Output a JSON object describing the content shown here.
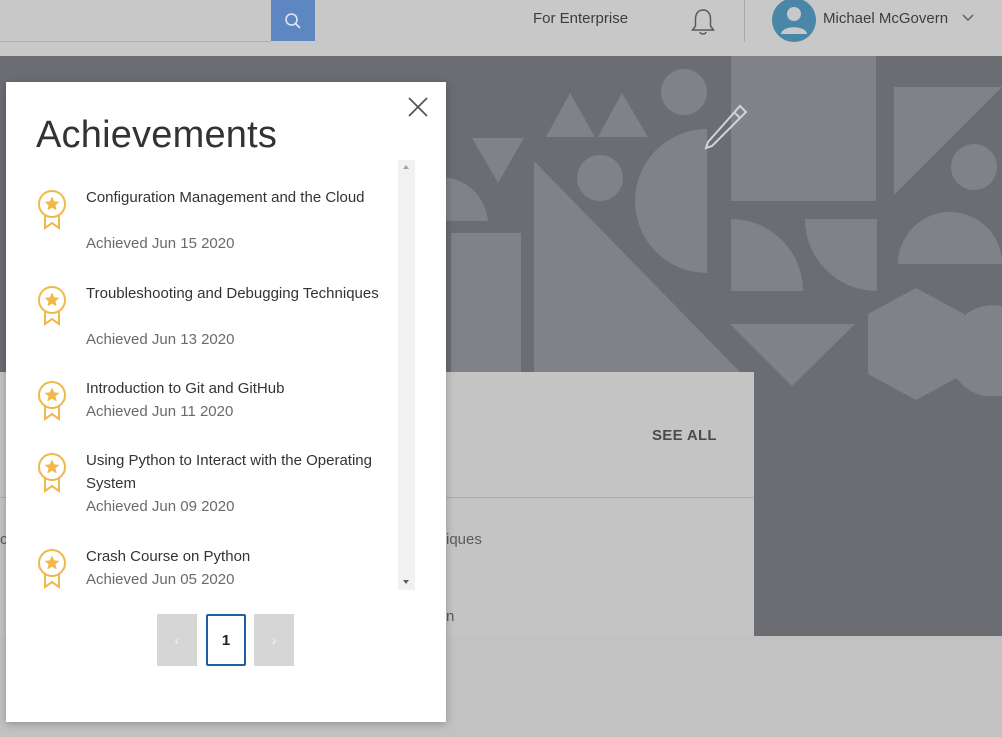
{
  "nav": {
    "enterprise_label": "For Enterprise",
    "user_name": "Michael McGovern"
  },
  "background": {
    "see_all_label": "SEE ALL",
    "course_text_1": "iques",
    "course_text_2": "n",
    "edge_text_1": "c"
  },
  "modal": {
    "title": "Achievements",
    "items": [
      {
        "name": "Configuration Management and the Cloud",
        "date": "Achieved Jun 15 2020"
      },
      {
        "name": "Troubleshooting and Debugging Techniques",
        "date": "Achieved Jun 13 2020"
      },
      {
        "name": "Introduction to Git and GitHub",
        "date": "Achieved Jun 11 2020"
      },
      {
        "name": "Using Python to Interact with the Operating System",
        "date": "Achieved Jun 09 2020"
      },
      {
        "name": "Crash Course on Python",
        "date": "Achieved Jun 05 2020"
      }
    ],
    "pagination": {
      "prev_label": "‹",
      "current_page": "1",
      "next_label": "›"
    }
  },
  "colors": {
    "accent_blue": "#1f5fa8",
    "badge_gold": "#f0b84a",
    "search_button": "#5e86c0"
  }
}
